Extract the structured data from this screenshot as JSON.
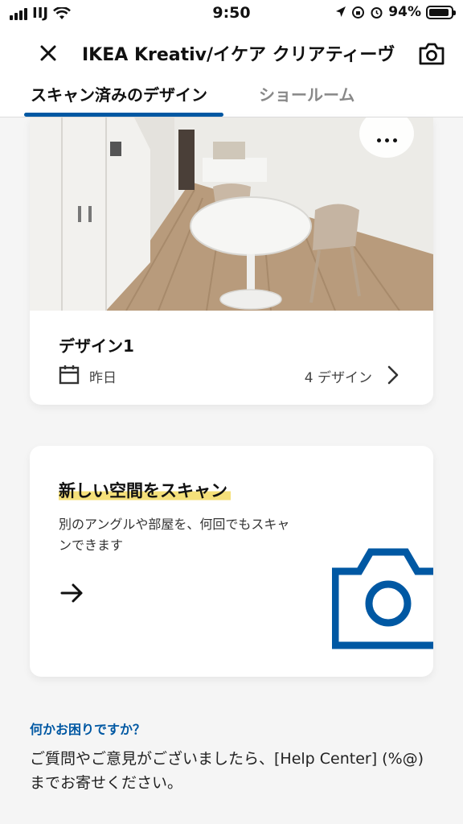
{
  "status_bar": {
    "carrier": "IIJ",
    "time": "9:50",
    "battery_percent": "94%",
    "battery_level": 0.94
  },
  "header": {
    "title": "IKEA Kreativ/イケア クリアティーヴ",
    "close_icon": "close-icon",
    "camera_icon": "camera-icon"
  },
  "tabs": [
    {
      "label": "スキャン済みのデザイン",
      "active": true
    },
    {
      "label": "ショールーム",
      "active": false
    }
  ],
  "design_card": {
    "name": "デザイン1",
    "date": "昨日",
    "count": "4 デザイン"
  },
  "scan_card": {
    "title": "新しい空間をスキャン",
    "description": "別のアングルや部屋を、何回でもスキャンできます"
  },
  "help": {
    "heading": "何かお困りですか？",
    "text": "ご質問やご意見がございましたら、[Help Center] (%@) までお寄せください。"
  },
  "colors": {
    "accent": "#0058a3",
    "highlight": "#f5e07a"
  }
}
